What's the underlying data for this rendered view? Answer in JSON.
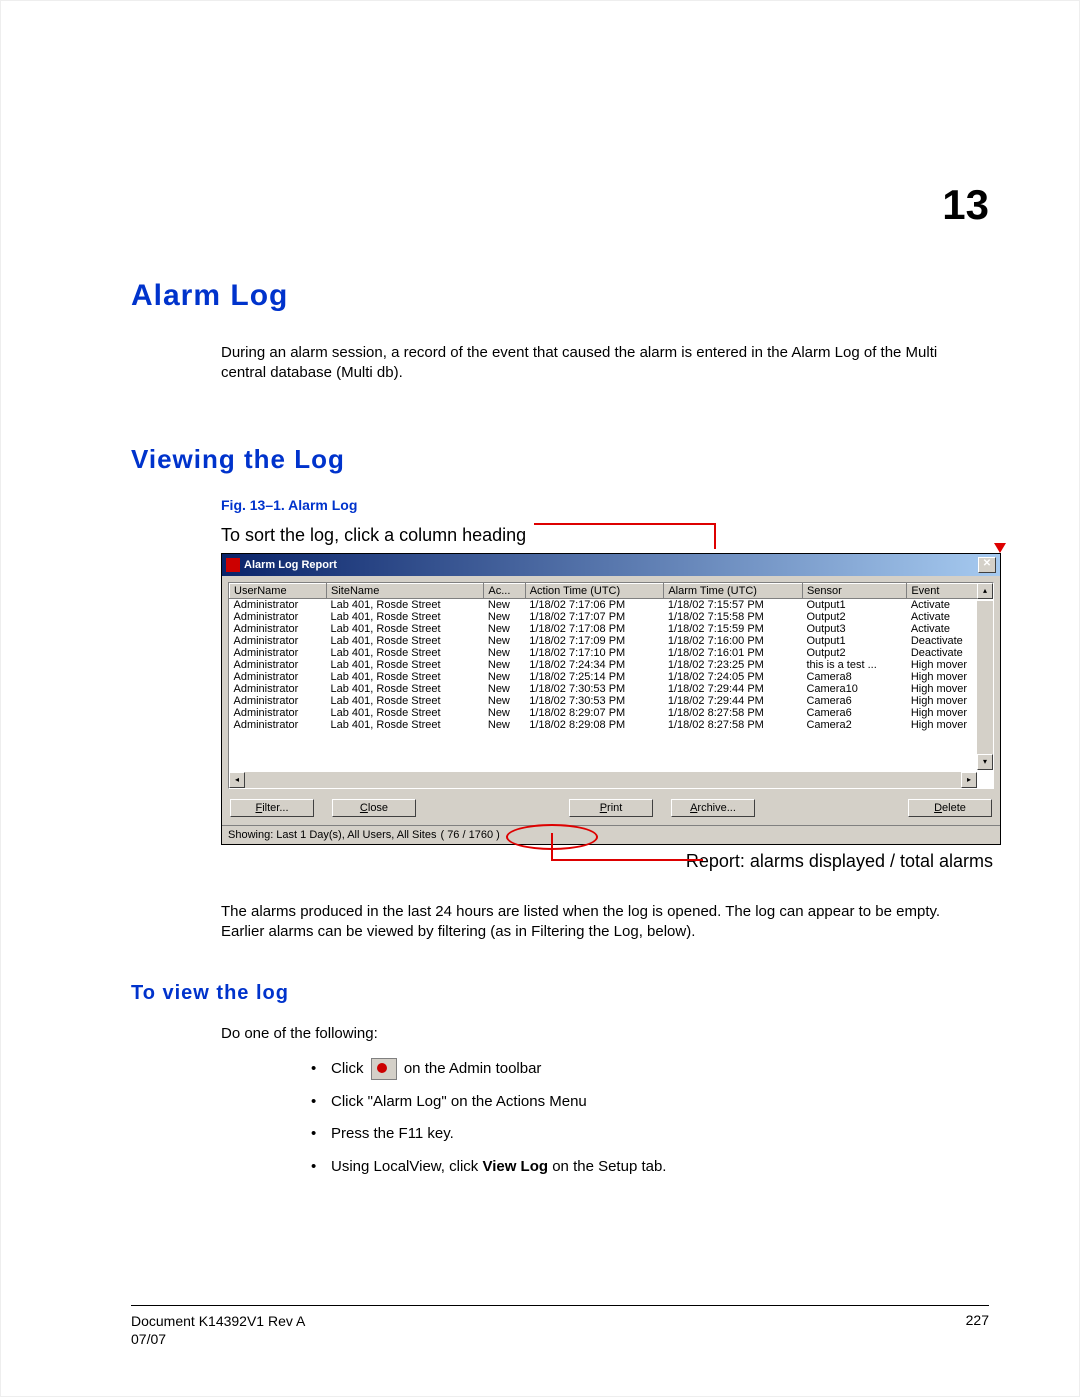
{
  "chapter_number": "13",
  "title": "Alarm Log",
  "intro": "During an alarm session, a record of the event that caused the alarm is entered in the Alarm Log of the Multi central database (Multi db).",
  "section_viewing": "Viewing the Log",
  "fig_caption": "Fig. 13–1.   Alarm Log",
  "annotation_top": "To sort the log, click a column heading",
  "annotation_bottom": "Report: alarms displayed / total alarms",
  "window": {
    "title": "Alarm Log Report",
    "columns": [
      "UserName",
      "SiteName",
      "Ac...",
      "Action Time (UTC)",
      "Alarm Time (UTC)",
      "Sensor",
      "Event"
    ],
    "rows": [
      [
        "Administrator",
        "Lab 401, Rosde Street",
        "New",
        "1/18/02 7:17:06 PM",
        "1/18/02 7:15:57 PM",
        "Output1",
        "Activate"
      ],
      [
        "Administrator",
        "Lab 401, Rosde Street",
        "New",
        "1/18/02 7:17:07 PM",
        "1/18/02 7:15:58 PM",
        "Output2",
        "Activate"
      ],
      [
        "Administrator",
        "Lab 401, Rosde Street",
        "New",
        "1/18/02 7:17:08 PM",
        "1/18/02 7:15:59 PM",
        "Output3",
        "Activate"
      ],
      [
        "Administrator",
        "Lab 401, Rosde Street",
        "New",
        "1/18/02 7:17:09 PM",
        "1/18/02 7:16:00 PM",
        "Output1",
        "Deactivate"
      ],
      [
        "Administrator",
        "Lab 401, Rosde Street",
        "New",
        "1/18/02 7:17:10 PM",
        "1/18/02 7:16:01 PM",
        "Output2",
        "Deactivate"
      ],
      [
        "Administrator",
        "Lab 401, Rosde Street",
        "New",
        "1/18/02 7:24:34 PM",
        "1/18/02 7:23:25 PM",
        "this is a test ...",
        "High mover"
      ],
      [
        "Administrator",
        "Lab 401, Rosde Street",
        "New",
        "1/18/02 7:25:14 PM",
        "1/18/02 7:24:05 PM",
        "Camera8",
        "High mover"
      ],
      [
        "Administrator",
        "Lab 401, Rosde Street",
        "New",
        "1/18/02 7:30:53 PM",
        "1/18/02 7:29:44 PM",
        "Camera10",
        "High mover"
      ],
      [
        "Administrator",
        "Lab 401, Rosde Street",
        "New",
        "1/18/02 7:30:53 PM",
        "1/18/02 7:29:44 PM",
        "Camera6",
        "High mover"
      ],
      [
        "Administrator",
        "Lab 401, Rosde Street",
        "New",
        "1/18/02 8:29:07 PM",
        "1/18/02 8:27:58 PM",
        "Camera6",
        "High mover"
      ],
      [
        "Administrator",
        "Lab 401, Rosde Street",
        "New",
        "1/18/02 8:29:08 PM",
        "1/18/02 8:27:58 PM",
        "Camera2",
        "High mover"
      ]
    ],
    "buttons": {
      "filter": "Filter...",
      "close": "Close",
      "print": "Print",
      "archive": "Archive...",
      "delete": "Delete"
    },
    "status_prefix": "Showing: Last 1 Day(s), All Users, All Sites",
    "status_count": "( 76 / 1760 )"
  },
  "after_fig": "The alarms produced in the last 24 hours are listed when the log is opened. The log can appear to be empty. Earlier alarms can be viewed by filtering (as in Filtering the Log, below).",
  "section_toview": "To view the log",
  "do_one": "Do one of the following:",
  "bullets": {
    "b1a": "Click ",
    "b1b": " on the Admin toolbar",
    "b2": "Click \"Alarm Log\" on the Actions Menu",
    "b3": "Press the F11 key.",
    "b4a": "Using LocalView, click ",
    "b4b": "View Log",
    "b4c": " on the Setup tab."
  },
  "footer": {
    "doc": "Document K14392V1 Rev A",
    "date": "07/07",
    "page": "227"
  }
}
